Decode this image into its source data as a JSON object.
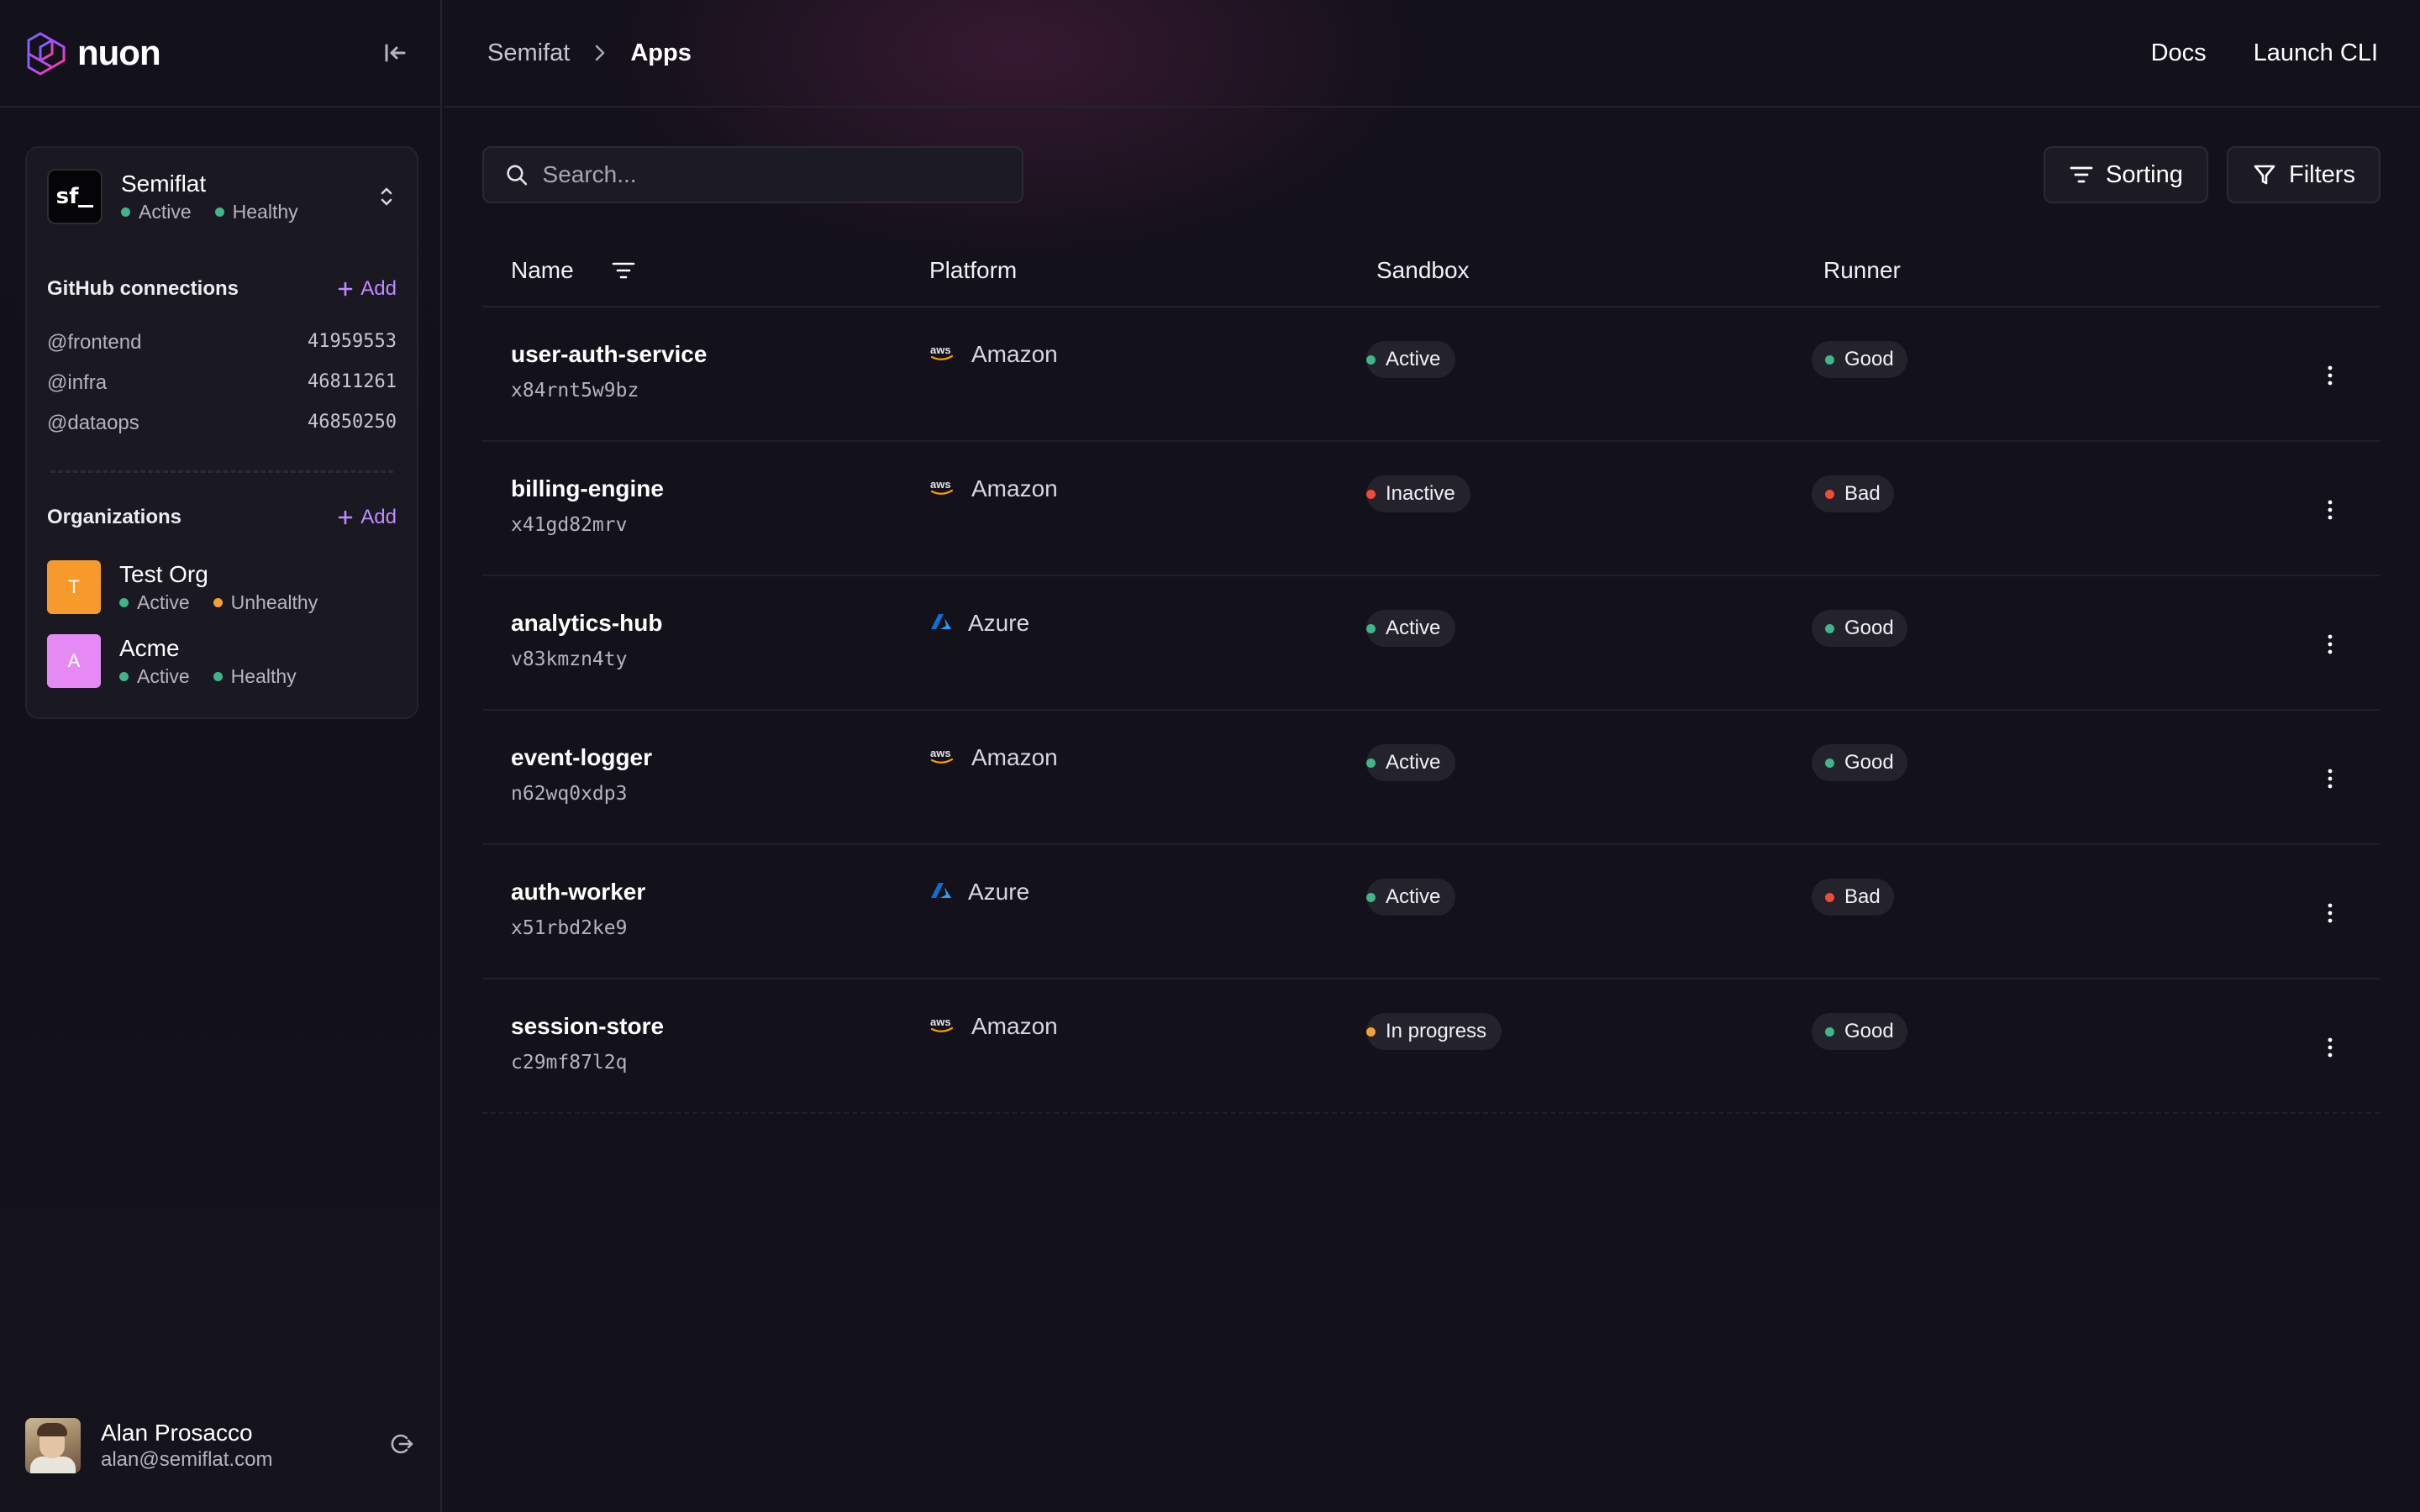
{
  "brand": {
    "name": "nuon"
  },
  "breadcrumb": {
    "parent": "Semifat",
    "current": "Apps"
  },
  "topnav": {
    "docs": "Docs",
    "launch_cli": "Launch CLI"
  },
  "org": {
    "name": "Semiflat",
    "avatar_text": "sf",
    "status": "Active",
    "health": "Healthy"
  },
  "github": {
    "title": "GitHub connections",
    "add_label": "Add",
    "connections": [
      {
        "handle": "@frontend",
        "id": "41959553"
      },
      {
        "handle": "@infra",
        "id": "46811261"
      },
      {
        "handle": "@dataops",
        "id": "46850250"
      }
    ]
  },
  "organizations": {
    "title": "Organizations",
    "add_label": "Add",
    "items": [
      {
        "initial": "T",
        "name": "Test Org",
        "status": "Active",
        "health": "Unhealthy",
        "color": "#f79a2c",
        "health_color": "#f59e3a"
      },
      {
        "initial": "A",
        "name": "Acme",
        "status": "Active",
        "health": "Healthy",
        "color": "#e58af5",
        "health_color": "#3eb58a"
      }
    ]
  },
  "user": {
    "name": "Alan Prosacco",
    "email": "alan@semiflat.com"
  },
  "search": {
    "placeholder": "Search..."
  },
  "toolbar": {
    "sorting": "Sorting",
    "filters": "Filters"
  },
  "table": {
    "headers": {
      "name": "Name",
      "platform": "Platform",
      "sandbox": "Sandbox",
      "runner": "Runner"
    },
    "rows": [
      {
        "name": "user-auth-service",
        "id": "x84rnt5w9bz",
        "platform": "Amazon",
        "platform_icon": "aws-icon",
        "sandbox": "Active",
        "sandbox_color": "#3eb58a",
        "runner": "Good",
        "runner_color": "#3eb58a"
      },
      {
        "name": "billing-engine",
        "id": "x41gd82mrv",
        "platform": "Amazon",
        "platform_icon": "aws-icon",
        "sandbox": "Inactive",
        "sandbox_color": "#ef4a3a",
        "runner": "Bad",
        "runner_color": "#ef4a3a"
      },
      {
        "name": "analytics-hub",
        "id": "v83kmzn4ty",
        "platform": "Azure",
        "platform_icon": "azure-icon",
        "sandbox": "Active",
        "sandbox_color": "#3eb58a",
        "runner": "Good",
        "runner_color": "#3eb58a"
      },
      {
        "name": "event-logger",
        "id": "n62wq0xdp3",
        "platform": "Amazon",
        "platform_icon": "aws-icon",
        "sandbox": "Active",
        "sandbox_color": "#3eb58a",
        "runner": "Good",
        "runner_color": "#3eb58a"
      },
      {
        "name": "auth-worker",
        "id": "x51rbd2ke9",
        "platform": "Azure",
        "platform_icon": "azure-icon",
        "sandbox": "Active",
        "sandbox_color": "#3eb58a",
        "runner": "Bad",
        "runner_color": "#ef4a3a"
      },
      {
        "name": "session-store",
        "id": "c29mf87l2q",
        "platform": "Amazon",
        "platform_icon": "aws-icon",
        "sandbox": "In progress",
        "sandbox_color": "#f59e3a",
        "runner": "Good",
        "runner_color": "#3eb58a"
      }
    ]
  }
}
